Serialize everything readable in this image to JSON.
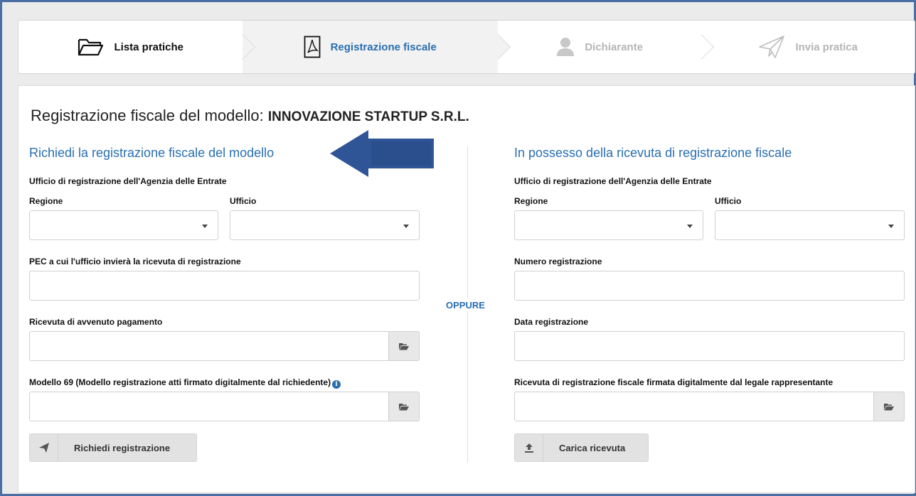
{
  "stepper": {
    "steps": [
      {
        "label": "Lista pratiche",
        "icon": "folder-icon",
        "state": "done"
      },
      {
        "label": "Registrazione fiscale",
        "icon": "pdf-icon",
        "state": "active"
      },
      {
        "label": "Dichiarante",
        "icon": "user-icon",
        "state": "disabled"
      },
      {
        "label": "Invia pratica",
        "icon": "paper-plane-icon",
        "state": "disabled"
      }
    ]
  },
  "page": {
    "title_prefix": "Registrazione fiscale del modello:",
    "company": "INNOVAZIONE STARTUP S.R.L."
  },
  "left": {
    "title": "Richiedi la registrazione fiscale del modello",
    "office_section": "Ufficio di registrazione dell'Agenzia delle Entrate",
    "regione_label": "Regione",
    "ufficio_label": "Ufficio",
    "regione_value": "",
    "ufficio_value": "",
    "pec_label": "PEC a cui l'ufficio invierà la ricevuta di registrazione",
    "pec_value": "",
    "ricevuta_label": "Ricevuta di avvenuto pagamento",
    "ricevuta_value": "",
    "modello_label": "Modello 69 (Modello registrazione atti firmato digitalmente dal richiedente)",
    "modello_value": "",
    "button_label": "Richiedi registrazione"
  },
  "separator": "OPPURE",
  "right": {
    "title": "In possesso della ricevuta di registrazione fiscale",
    "office_section": "Ufficio di registrazione dell'Agenzia delle Entrate",
    "regione_label": "Regione",
    "ufficio_label": "Ufficio",
    "regione_value": "",
    "ufficio_value": "",
    "numero_label": "Numero registrazione",
    "numero_value": "",
    "data_label": "Data registrazione",
    "data_value": "",
    "ricevuta_label": "Ricevuta di registrazione fiscale firmata digitalmente dal legale rappresentante",
    "ricevuta_value": "",
    "button_label": "Carica ricevuta"
  },
  "colors": {
    "accent": "#2a6fb0",
    "annotation_arrow": "#2f5597",
    "disabled_step": "#b5b5b5"
  }
}
